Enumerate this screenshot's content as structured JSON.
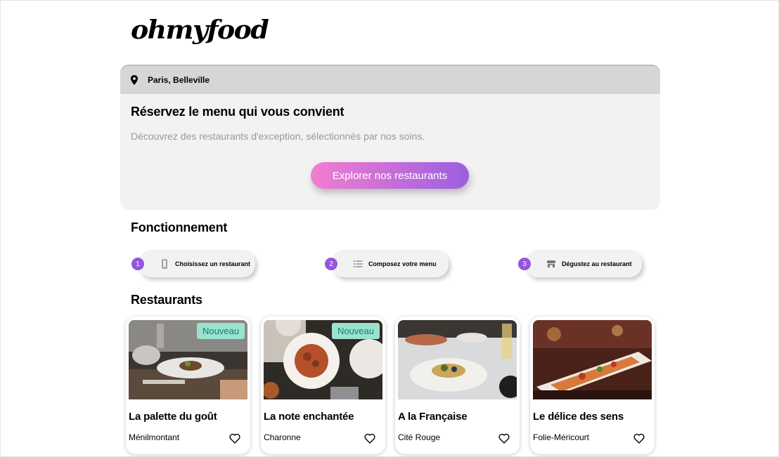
{
  "header": {
    "logo": "ohmyfood"
  },
  "hero": {
    "location": "Paris, Belleville",
    "title": "Réservez le menu qui vous convient",
    "subtitle": "Découvrez des restaurants d'exception, sélectionnés par nos soins.",
    "cta_label": "Explorer nos restaurants"
  },
  "how_it_works": {
    "title": "Fonctionnement",
    "steps": [
      {
        "number": "1",
        "label": "Choisissez un restaurant",
        "icon": "mobile-icon"
      },
      {
        "number": "2",
        "label": "Composez votre menu",
        "icon": "list-icon"
      },
      {
        "number": "3",
        "label": "Dégustez au restaurant",
        "icon": "store-icon"
      }
    ]
  },
  "restaurants": {
    "title": "Restaurants",
    "items": [
      {
        "name": "La palette du goût",
        "location": "Ménilmontant",
        "badge": "Nouveau"
      },
      {
        "name": "La note enchantée",
        "location": "Charonne",
        "badge": "Nouveau"
      },
      {
        "name": "A la Française",
        "location": "Cité Rouge"
      },
      {
        "name": "Le délice des sens",
        "location": "Folie-Méricourt"
      }
    ]
  },
  "colors": {
    "accent_purple": "#9356dc",
    "gradient_start": "#f27ed0",
    "gradient_end": "#9b5fe0",
    "badge_bg": "#99e2d0",
    "badge_text": "#148064"
  }
}
